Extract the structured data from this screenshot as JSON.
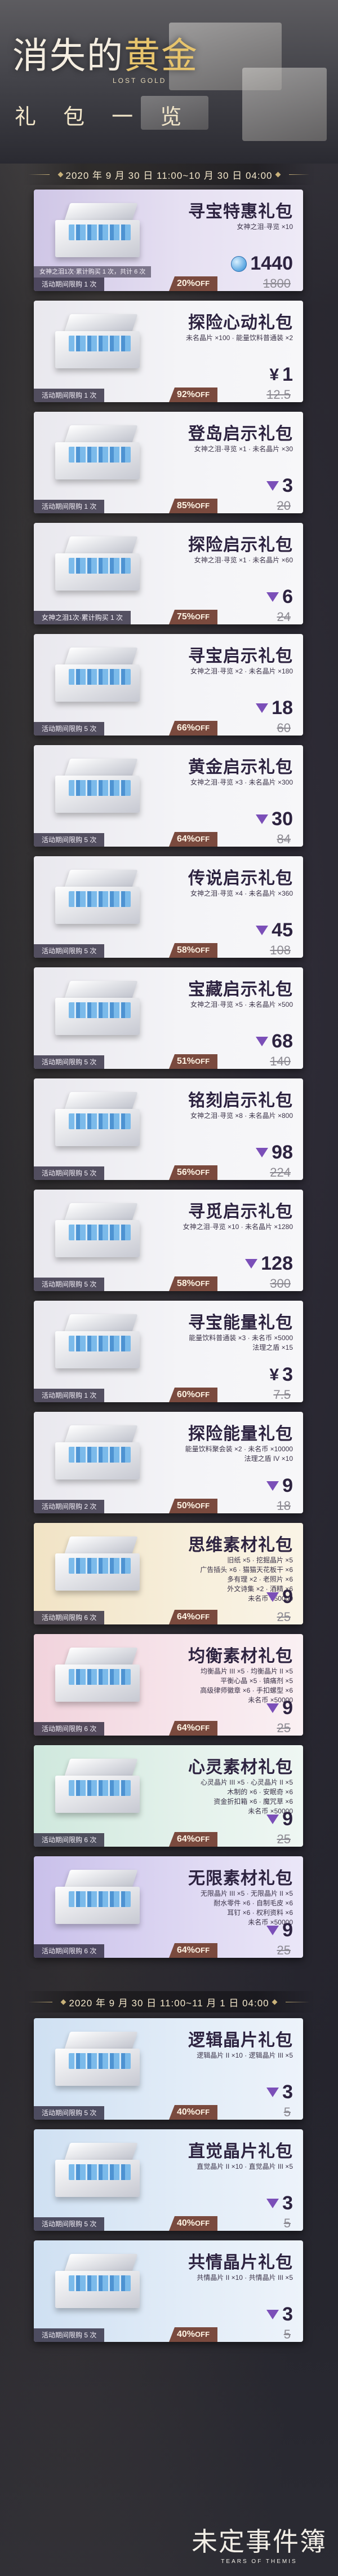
{
  "header": {
    "title_a": "消失的",
    "title_b": "黄金",
    "eng": "LOST GOLD",
    "subtitle": "礼 包 一 览"
  },
  "period1": "2020 年 9 月 30 日 11:00~10 月 30 日 04:00",
  "period2": "2020 年 9 月 30 日 11:00~11 月 1 日 04:00",
  "colors": {
    "discount_bg": "#7a4a3e",
    "gem": "#7b4fb8"
  },
  "packs": [
    {
      "name": "寻宝特惠礼包",
      "items": [
        "女神之泪·寻览 ×10"
      ],
      "currency": "coin",
      "price": "1440",
      "discount": "20%",
      "orig": "1800",
      "limit": "活动期间限购 1 次",
      "limit2": "女神之泪1次·累计购买 1 次，共计 6 次",
      "theme": "purple"
    },
    {
      "name": "探险心动礼包",
      "items": [
        "未名晶片 ×100 · 能量饮料普通装 ×2"
      ],
      "currency": "yen",
      "price": "1",
      "discount": "92%",
      "orig": "12.5",
      "limit": "活动期间限购 1 次",
      "theme": "white"
    },
    {
      "name": "登岛启示礼包",
      "items": [
        "女神之泪·寻览 ×1 · 未名晶片 ×30"
      ],
      "currency": "gem",
      "price": "3",
      "discount": "85%",
      "orig": "20",
      "limit": "活动期间限购 1 次",
      "theme": "white"
    },
    {
      "name": "探险启示礼包",
      "items": [
        "女神之泪·寻览 ×1 · 未名晶片 ×60"
      ],
      "currency": "gem",
      "price": "6",
      "discount": "75%",
      "orig": "24",
      "limit": "女神之泪1次·累计购买 1 次",
      "theme": "white"
    },
    {
      "name": "寻宝启示礼包",
      "items": [
        "女神之泪·寻览 ×2 · 未名晶片 ×180"
      ],
      "currency": "gem",
      "price": "18",
      "discount": "66%",
      "orig": "60",
      "limit": "活动期间限购 5 次",
      "theme": "white"
    },
    {
      "name": "黄金启示礼包",
      "items": [
        "女神之泪·寻览 ×3 · 未名晶片 ×300"
      ],
      "currency": "gem",
      "price": "30",
      "discount": "64%",
      "orig": "84",
      "limit": "活动期间限购 5 次",
      "theme": "white"
    },
    {
      "name": "传说启示礼包",
      "items": [
        "女神之泪·寻览 ×4 · 未名晶片 ×360"
      ],
      "currency": "gem",
      "price": "45",
      "discount": "58%",
      "orig": "108",
      "limit": "活动期间限购 5 次",
      "theme": "white"
    },
    {
      "name": "宝藏启示礼包",
      "items": [
        "女神之泪·寻览 ×5 · 未名晶片 ×500"
      ],
      "currency": "gem",
      "price": "68",
      "discount": "51%",
      "orig": "140",
      "limit": "活动期间限购 5 次",
      "theme": "white"
    },
    {
      "name": "铭刻启示礼包",
      "items": [
        "女神之泪·寻览 ×8 · 未名晶片 ×800"
      ],
      "currency": "gem",
      "price": "98",
      "discount": "56%",
      "orig": "224",
      "limit": "活动期间限购 5 次",
      "theme": "white"
    },
    {
      "name": "寻觅启示礼包",
      "items": [
        "女神之泪·寻览 ×10 · 未名晶片 ×1280"
      ],
      "currency": "gem",
      "price": "128",
      "discount": "58%",
      "orig": "300",
      "limit": "活动期间限购 5 次",
      "theme": "white"
    },
    {
      "name": "寻宝能量礼包",
      "items": [
        "能量饮料普通装 ×3 · 未名币 ×5000",
        "法理之盾 ×15"
      ],
      "currency": "yen",
      "price": "3",
      "discount": "60%",
      "orig": "7.5",
      "limit": "活动期间限购 1 次",
      "theme": "white"
    },
    {
      "name": "探险能量礼包",
      "items": [
        "能量饮料聚会装 ×2 · 未名币 ×10000",
        "法理之盾 IV ×10"
      ],
      "currency": "gem",
      "price": "9",
      "discount": "50%",
      "orig": "18",
      "limit": "活动期间限购 2 次",
      "theme": "white"
    },
    {
      "name": "思维素材礼包",
      "items": [
        "旧纸 ×5 · 挖掘晶片 ×5",
        "广告插头 ×6 · 猫猫天花板干 ×6",
        "多有理 ×2 · 老照片 ×6",
        "外文诗集 ×2 · 酒精 ×6",
        "未名币 ×50000"
      ],
      "currency": "gem",
      "price": "9",
      "discount": "64%",
      "orig": "25",
      "limit": "活动期间限购 6 次",
      "theme": "gold"
    },
    {
      "name": "均衡素材礼包",
      "items": [
        "均衡晶片 III ×5 · 均衡晶片 II ×5",
        "平衡心晶 ×5 · 镇痛剂 ×5",
        "高级律师徽章 ×6 · 手扣螺型 ×6",
        "未名币 ×50000"
      ],
      "currency": "gem",
      "price": "9",
      "discount": "64%",
      "orig": "25",
      "limit": "活动期间限购 6 次",
      "theme": "pink"
    },
    {
      "name": "心灵素材礼包",
      "items": [
        "心灵晶片 III ×5 · 心灵晶片 II ×5",
        "木制的 ×6 · 安眠奇 ×6",
        "资金折扣箱 ×6 · 魔咒草 ×6",
        "未名币 ×50000"
      ],
      "currency": "gem",
      "price": "9",
      "discount": "64%",
      "orig": "25",
      "limit": "活动期间限购 6 次",
      "theme": "green"
    },
    {
      "name": "无限素材礼包",
      "items": [
        "无限晶片 III ×5 · 无限晶片 II ×5",
        "耐水零件 ×6 · 自制毛皮 ×6",
        "耳钉 ×6 · 权利资料 ×6",
        "未名币 ×50000"
      ],
      "currency": "gem",
      "price": "9",
      "discount": "64%",
      "orig": "25",
      "limit": "活动期间限购 6 次",
      "theme": "violet"
    },
    {
      "name": "逻辑晶片礼包",
      "items": [
        "逻辑晶片 II ×10 · 逻辑晶片 III ×5"
      ],
      "currency": "gem",
      "price": "3",
      "discount": "40%",
      "orig": "5",
      "limit": "活动期间限购 5 次",
      "theme": "blue"
    },
    {
      "name": "直觉晶片礼包",
      "items": [
        "直觉晶片 II ×10 · 直觉晶片 III ×5"
      ],
      "currency": "gem",
      "price": "3",
      "discount": "40%",
      "orig": "5",
      "limit": "活动期间限购 5 次",
      "theme": "blue"
    },
    {
      "name": "共情晶片礼包",
      "items": [
        "共情晶片 II ×10 · 共情晶片 III ×5"
      ],
      "currency": "gem",
      "price": "3",
      "discount": "40%",
      "orig": "5",
      "limit": "活动期间限购 5 次",
      "theme": "blue"
    }
  ],
  "footer": {
    "logo": "未定事件簿",
    "eng": "TEARS OF THEMIS"
  }
}
